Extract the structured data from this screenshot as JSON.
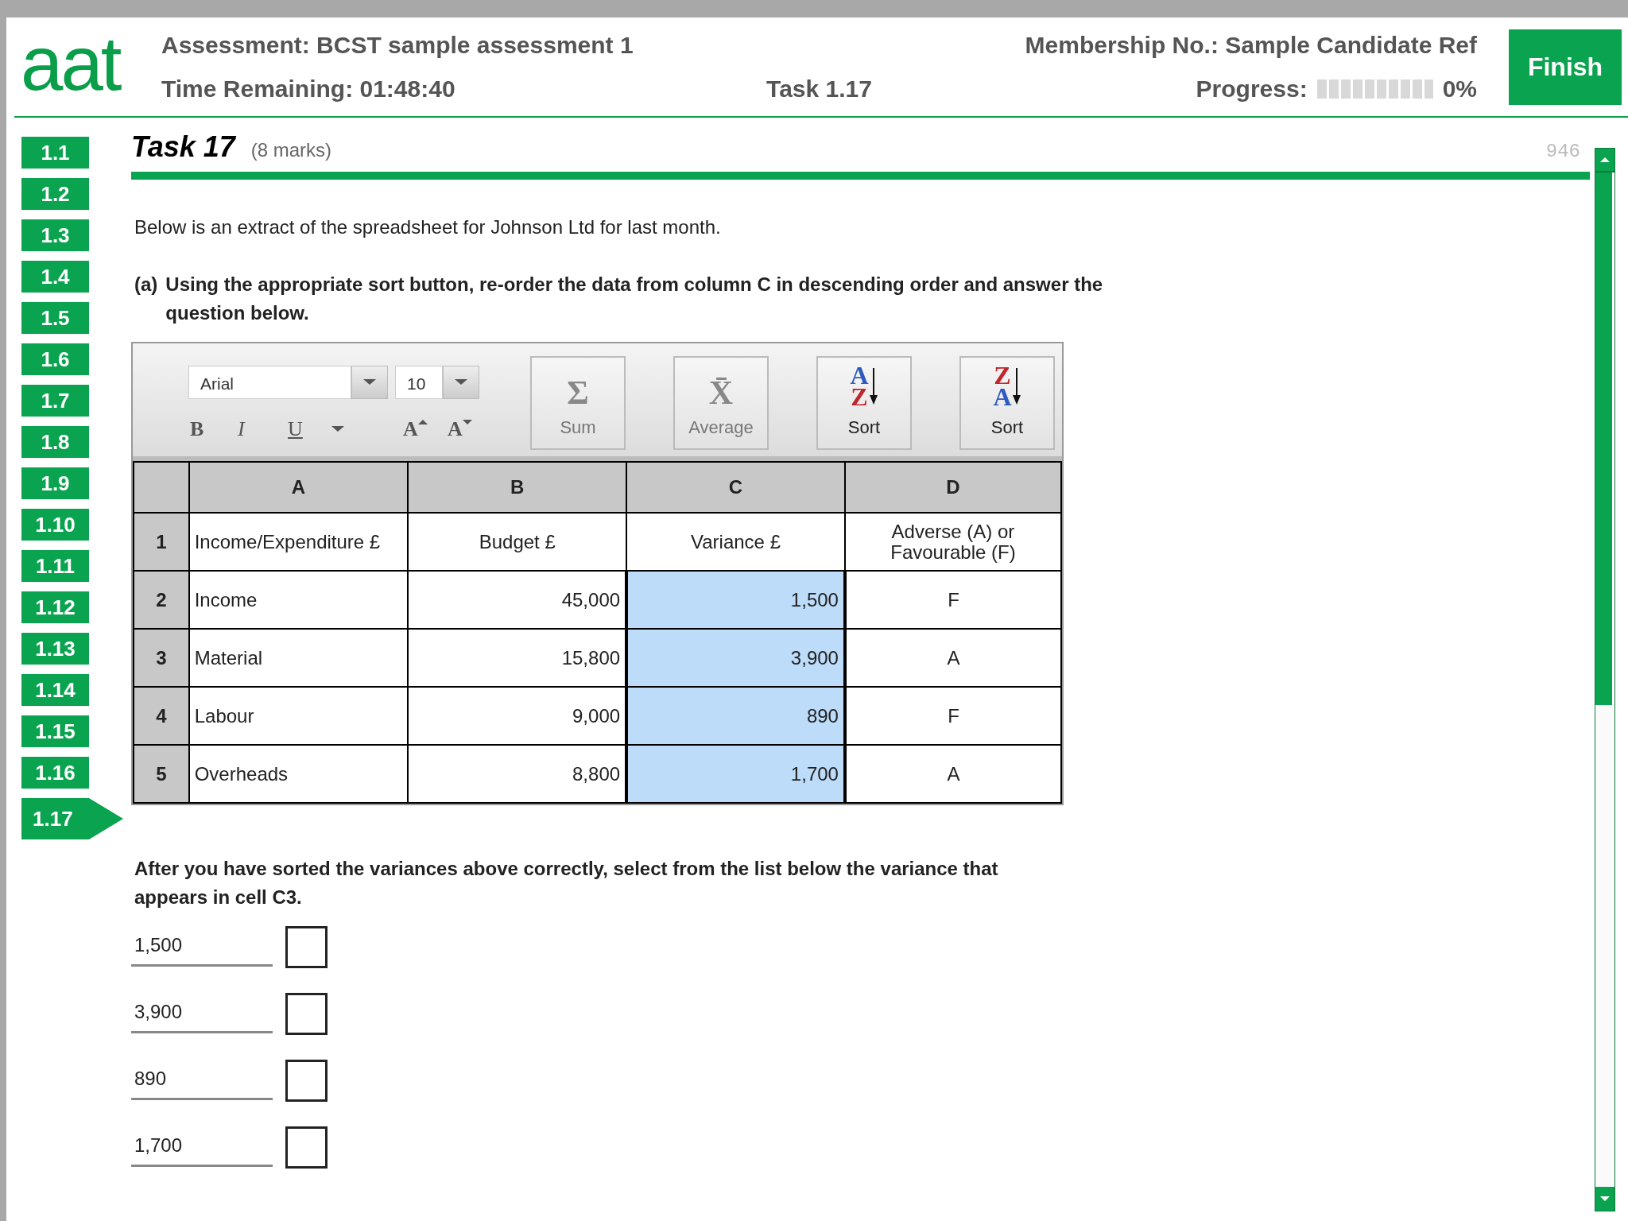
{
  "header": {
    "logo": "aat",
    "title": "Assessment: BCST sample assessment 1",
    "time_remaining": "Time Remaining: 01:48:40",
    "task": "Task 1.17",
    "membership": "Membership No.: Sample Candidate Ref",
    "progress": {
      "label": "Progress:",
      "level": 0,
      "reading": "0%"
    },
    "finish_button": "Finish"
  },
  "sidebar": {
    "items": [
      {
        "label": "1.1",
        "selected": false
      },
      {
        "label": "1.2",
        "selected": false
      },
      {
        "label": "1.3",
        "selected": false
      },
      {
        "label": "1.4",
        "selected": false
      },
      {
        "label": "1.5",
        "selected": false
      },
      {
        "label": "1.6",
        "selected": false
      },
      {
        "label": "1.7",
        "selected": false
      },
      {
        "label": "1.8",
        "selected": false
      },
      {
        "label": "1.9",
        "selected": false
      },
      {
        "label": "1.10",
        "selected": false
      },
      {
        "label": "1.11",
        "selected": false
      },
      {
        "label": "1.12",
        "selected": false
      },
      {
        "label": "1.13",
        "selected": false
      },
      {
        "label": "1.14",
        "selected": false
      },
      {
        "label": "1.15",
        "selected": false
      },
      {
        "label": "1.16",
        "selected": false
      },
      {
        "label": "1.17",
        "selected": true
      }
    ]
  },
  "task": {
    "title": "Task 17",
    "marks": "(8 marks)",
    "counter": "946"
  },
  "intro": "Below is an extract of the spreadsheet for Johnson Ltd for last month.",
  "question_a": {
    "label": "(a)",
    "text": "Using the appropriate sort button, re-order the data from column C in descending order and answer the question below."
  },
  "toolbar": {
    "font": "Arial",
    "size": "10",
    "format_buttons": [
      "B",
      "I",
      "U"
    ],
    "size_buttons": [
      {
        "glyph": "A",
        "kind": "grow"
      },
      {
        "glyph": "A",
        "kind": "shrink"
      }
    ],
    "buttons": [
      {
        "kind": "sum",
        "glyphs": [
          "Σ"
        ],
        "label": "Sum",
        "disabled": true
      },
      {
        "kind": "average",
        "glyphs": [
          "X̄"
        ],
        "label": "Average",
        "disabled": true
      },
      {
        "kind": "sort_asc",
        "glyphs": [
          "A",
          "Z"
        ],
        "label": "Sort",
        "disabled": false
      },
      {
        "kind": "sort_desc",
        "glyphs": [
          "Z",
          "A"
        ],
        "label": "Sort",
        "disabled": false
      }
    ]
  },
  "sheet": {
    "columns": [
      "A",
      "B",
      "C",
      "D"
    ],
    "rows": [
      {
        "number": "1",
        "cells": [
          {
            "text": "Income/Expenditure £",
            "selected": false
          },
          {
            "text": "Budget £",
            "selected": false
          },
          {
            "text": "Variance £",
            "selected": false
          },
          {
            "text": "Adverse (A) or Favourable (F)",
            "selected": false
          }
        ]
      },
      {
        "number": "2",
        "cells": [
          {
            "text": "Income",
            "selected": false
          },
          {
            "text": "45,000",
            "selected": false
          },
          {
            "text": "1,500",
            "selected": true
          },
          {
            "text": "F",
            "selected": false
          }
        ]
      },
      {
        "number": "3",
        "cells": [
          {
            "text": "Material",
            "selected": false
          },
          {
            "text": "15,800",
            "selected": false
          },
          {
            "text": "3,900",
            "selected": true
          },
          {
            "text": "A",
            "selected": false
          }
        ]
      },
      {
        "number": "4",
        "cells": [
          {
            "text": "Labour",
            "selected": false
          },
          {
            "text": "9,000",
            "selected": false
          },
          {
            "text": "890",
            "selected": true
          },
          {
            "text": "F",
            "selected": false
          }
        ]
      },
      {
        "number": "5",
        "cells": [
          {
            "text": "Overheads",
            "selected": false
          },
          {
            "text": "8,800",
            "selected": false
          },
          {
            "text": "1,700",
            "selected": true
          },
          {
            "text": "A",
            "selected": false
          }
        ]
      }
    ]
  },
  "question": "After you have sorted the variances above correctly, select from the list below the variance that appears in cell C3.",
  "options": [
    {
      "value": "1,500",
      "checked": false
    },
    {
      "value": "3,900",
      "checked": false
    },
    {
      "value": "890",
      "checked": false
    },
    {
      "value": "1,700",
      "checked": false
    }
  ]
}
